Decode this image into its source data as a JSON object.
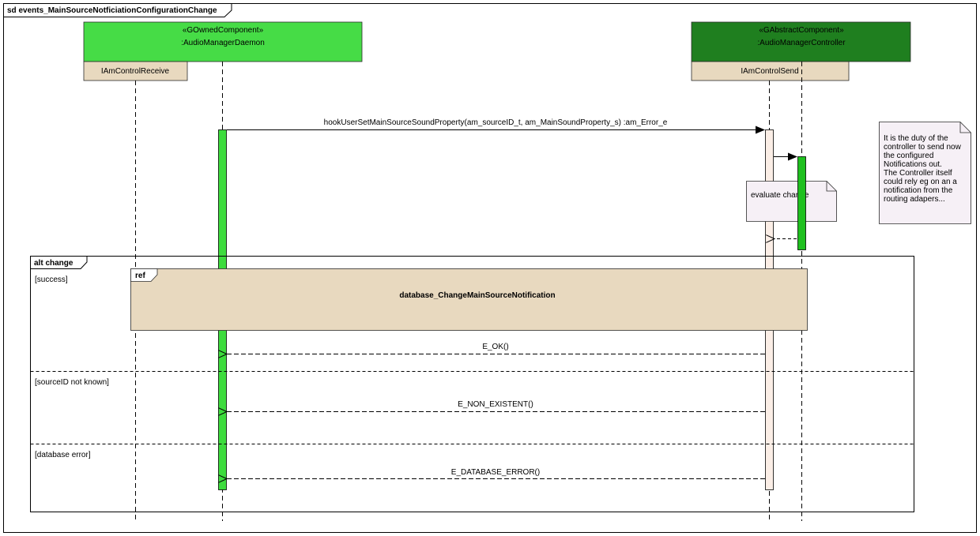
{
  "frame": {
    "title": "sd events_MainSourceNotficiationConfigurationChange"
  },
  "lifelines": {
    "daemon": {
      "stereotype": "«GOwnedComponent»",
      "name": ":AudioManagerDaemon",
      "fill": "#46dc46"
    },
    "controller": {
      "stereotype": "«GAbstractComponent»",
      "name": ":AudioManagerController",
      "fill": "#1f7f1f"
    },
    "receive_port": "IAmControlReceive",
    "send_port": "IAmControlSend"
  },
  "messages": {
    "hook_call": "hookUserSetMainSourceSoundProperty(am_sourceID_t, am_MainSoundProperty_s) :am_Error_e",
    "return_ok": "E_OK()",
    "return_non_existent": "E_NON_EXISTENT()",
    "return_db_error": "E_DATABASE_ERROR()"
  },
  "notes": {
    "evaluate": "evaluate change",
    "duty": [
      "It is the duty of the",
      "controller to send now",
      "the configured",
      "Notifications out.",
      "The Controller itself",
      "could rely eg on an a",
      "notification from the",
      "routing adapers..."
    ]
  },
  "alt": {
    "label": "alt change",
    "guards": {
      "success": "[success]",
      "not_known": "[sourceID not known]",
      "db_error": "[database error]"
    }
  },
  "ref": {
    "tag": "ref",
    "name": "database_ChangeMainSourceNotification"
  },
  "colors": {
    "port_fill": "#e8d9bf",
    "activation_green": "#3ddc3d",
    "activation_dark": "#1fc01f",
    "activation_pale": "#fbeee6",
    "note_fill": "#f6f0f6",
    "ref_fill": "#e8d9bf"
  }
}
